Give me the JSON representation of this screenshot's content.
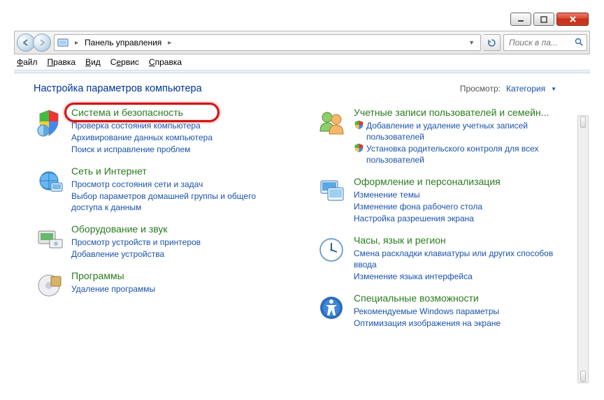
{
  "window": {
    "address_path": "Панель управления",
    "search_placeholder": "Поиск в па..."
  },
  "menu": {
    "file": "Файл",
    "edit": "Правка",
    "view": "Вид",
    "service": "Сервис",
    "help": "Справка"
  },
  "header": {
    "title": "Настройка параметров компьютера",
    "view_label": "Просмотр:",
    "view_value": "Категория"
  },
  "categories": {
    "left": [
      {
        "title": "Система и безопасность",
        "links": [
          {
            "text": "Проверка состояния компьютера"
          },
          {
            "text": "Архивирование данных компьютера"
          },
          {
            "text": "Поиск и исправление проблем"
          }
        ],
        "highlight": true
      },
      {
        "title": "Сеть и Интернет",
        "links": [
          {
            "text": "Просмотр состояния сети и задач"
          },
          {
            "text": "Выбор параметров домашней группы и общего доступа к данным"
          }
        ]
      },
      {
        "title": "Оборудование и звук",
        "links": [
          {
            "text": "Просмотр устройств и принтеров"
          },
          {
            "text": "Добавление устройства"
          }
        ]
      },
      {
        "title": "Программы",
        "links": [
          {
            "text": "Удаление программы"
          }
        ]
      }
    ],
    "right": [
      {
        "title": "Учетные записи пользователей и семейн...",
        "links": [
          {
            "text": "Добавление и удаление учетных записей пользователей",
            "shield": true
          },
          {
            "text": "Установка родительского контроля для всех пользователей",
            "shield": true
          }
        ]
      },
      {
        "title": "Оформление и персонализация",
        "links": [
          {
            "text": "Изменение темы"
          },
          {
            "text": "Изменение фона рабочего стола"
          },
          {
            "text": "Настройка разрешения экрана"
          }
        ]
      },
      {
        "title": "Часы, язык и регион",
        "links": [
          {
            "text": "Смена раскладки клавиатуры или других способов ввода"
          },
          {
            "text": "Изменение языка интерфейса"
          }
        ]
      },
      {
        "title": "Специальные возможности",
        "links": [
          {
            "text": "Рекомендуемые Windows параметры"
          },
          {
            "text": "Оптимизация изображения на экране"
          }
        ]
      }
    ]
  }
}
